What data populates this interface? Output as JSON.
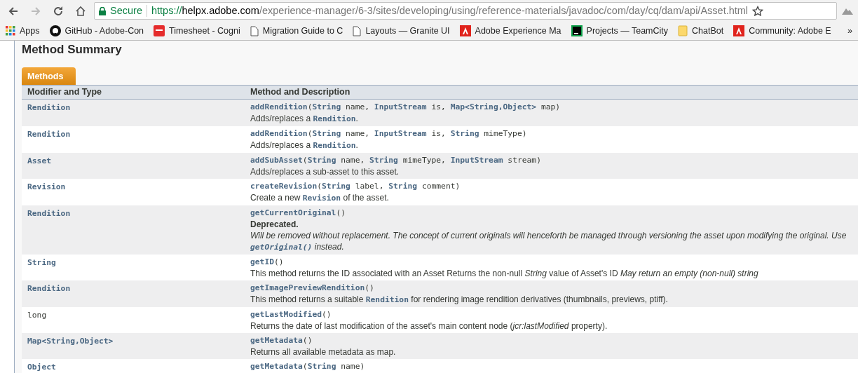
{
  "browser": {
    "secure_label": "Secure",
    "url": {
      "scheme": "https://",
      "host": "helpx.adobe.com",
      "path": "/experience-manager/6-3/sites/developing/using/reference-materials/javadoc/com/day/cq/dam/api/Asset.html"
    },
    "bookmarks": [
      {
        "kind": "apps",
        "label": "Apps"
      },
      {
        "kind": "github",
        "label": "GitHub - Adobe-Con"
      },
      {
        "kind": "oracle",
        "label": "Timesheet - Cogni"
      },
      {
        "kind": "page",
        "label": "Migration Guide to C"
      },
      {
        "kind": "page",
        "label": "Layouts — Granite UI"
      },
      {
        "kind": "adobe",
        "label": "Adobe Experience Ma"
      },
      {
        "kind": "teamcity",
        "label": "Projects — TeamCity"
      },
      {
        "kind": "folder",
        "label": "ChatBot"
      },
      {
        "kind": "adobe",
        "label": "Community: Adobe E"
      }
    ],
    "overflow": "»"
  },
  "page": {
    "heading": "Method Summary",
    "tab": "Methods",
    "columns": [
      "Modifier and Type",
      "Method and Description"
    ],
    "rows": [
      {
        "type": "Rendition",
        "type_link": true,
        "signature": "**addRendition**(**String** name, **InputStream** is, **Map<String,Object>** map)",
        "description": "Adds/replaces a **Rendition**."
      },
      {
        "type": "Rendition",
        "type_link": true,
        "signature": "**addRendition**(**String** name, **InputStream** is, **String** mimeType)",
        "description": "Adds/replaces a **Rendition**."
      },
      {
        "type": "Asset",
        "type_link": true,
        "signature": "**addSubAsset**(**String** name, **String** mimeType, **InputStream** stream)",
        "description": "Adds/replaces a sub-asset to this asset."
      },
      {
        "type": "Revision",
        "type_link": true,
        "signature": "**createRevision**(**String** label, **String** comment)",
        "description": "Create a new **Revision** of the asset."
      },
      {
        "type": "Rendition",
        "type_link": true,
        "signature": "**getCurrentOriginal**()",
        "deprecated": "Deprecated.",
        "note": "Will be removed without replacement. The concept of current originals will henceforth be managed through versioning the asset upon modifying the original. Use **getOriginal()** instead."
      },
      {
        "type": "String",
        "type_link": true,
        "signature": "**getID**()",
        "description": "This method returns the ID associated with an Asset Returns the non-null *String* value of Asset's ID *May return an empty (non-null) string*"
      },
      {
        "type": "Rendition",
        "type_link": true,
        "signature": "**getImagePreviewRendition**()",
        "description": "This method returns a suitable **Rendition** for rendering image rendition derivatives (thumbnails, previews, ptiff)."
      },
      {
        "type": "long",
        "type_link": false,
        "signature": "**getLastModified**()",
        "description": "Returns the date of last modification of the asset's main content node (*jcr:lastModified* property)."
      },
      {
        "type": "Map<String,Object>",
        "type_link": true,
        "signature": "**getMetadata**()",
        "description": "Returns all available metadata as map."
      },
      {
        "type": "Object",
        "type_link": true,
        "signature": "**getMetadata**(**String** name)"
      }
    ]
  }
}
